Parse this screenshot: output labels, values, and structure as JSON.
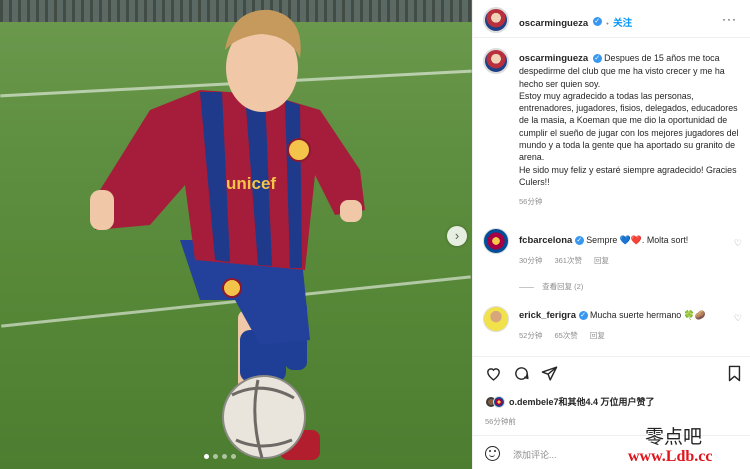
{
  "post": {
    "username": "oscarmingueza",
    "follow_label": "关注",
    "more_label": "···",
    "caption_lines": [
      "Despues de 15 años me toca despedirme del club que me ha visto crecer y me ha hecho ser quien soy.",
      "Estoy muy agradecido a todas las personas, entrenadores, jugadores, fisios, delegados, educadores de la masia, a Koeman que me dio la oportunidad de cumplir el sueño de jugar con los mejores jugadores del mundo y a toda la gente que ha aportado su granito de arena.",
      "He sido muy feliz y estaré siempre agradecido! Gracies Culers!!"
    ],
    "caption_time": "56分钟"
  },
  "photo": {
    "shirt_text": "unicef",
    "next_label": "›"
  },
  "comments": [
    {
      "username": "fcbarcelona",
      "text": "Sempre 💙❤️. Molta sort!",
      "time": "30分钟",
      "likes": "361次赞",
      "reply": "回复",
      "view_replies": "查看回复 (2)"
    },
    {
      "username": "erick_ferigra",
      "text": "Mucha suerte hermano 🍀🥔",
      "time": "52分钟",
      "likes": "65次赞",
      "reply": "回复"
    }
  ],
  "likes_line": "o.dembele7和其他4.4 万位用户赞了",
  "likes_user": "o.dembele7",
  "likes_rest": "和其他4.4 万位用户赞了",
  "time_ago": "56分钟前",
  "add_comment_placeholder": "添加评论...",
  "icons": [
    "heart-icon",
    "comment-icon",
    "share-icon",
    "bookmark-icon",
    "emoji-icon",
    "more-icon",
    "verified-icon",
    "next-arrow-icon"
  ],
  "watermark": {
    "line1": "零点吧",
    "line2": "www.Ldb.cc"
  },
  "colors": {
    "link": "#0095f6",
    "verified": "#3897f0",
    "muted": "#8e8e8e",
    "text": "#262626",
    "watermark_red": "#e0141c"
  }
}
